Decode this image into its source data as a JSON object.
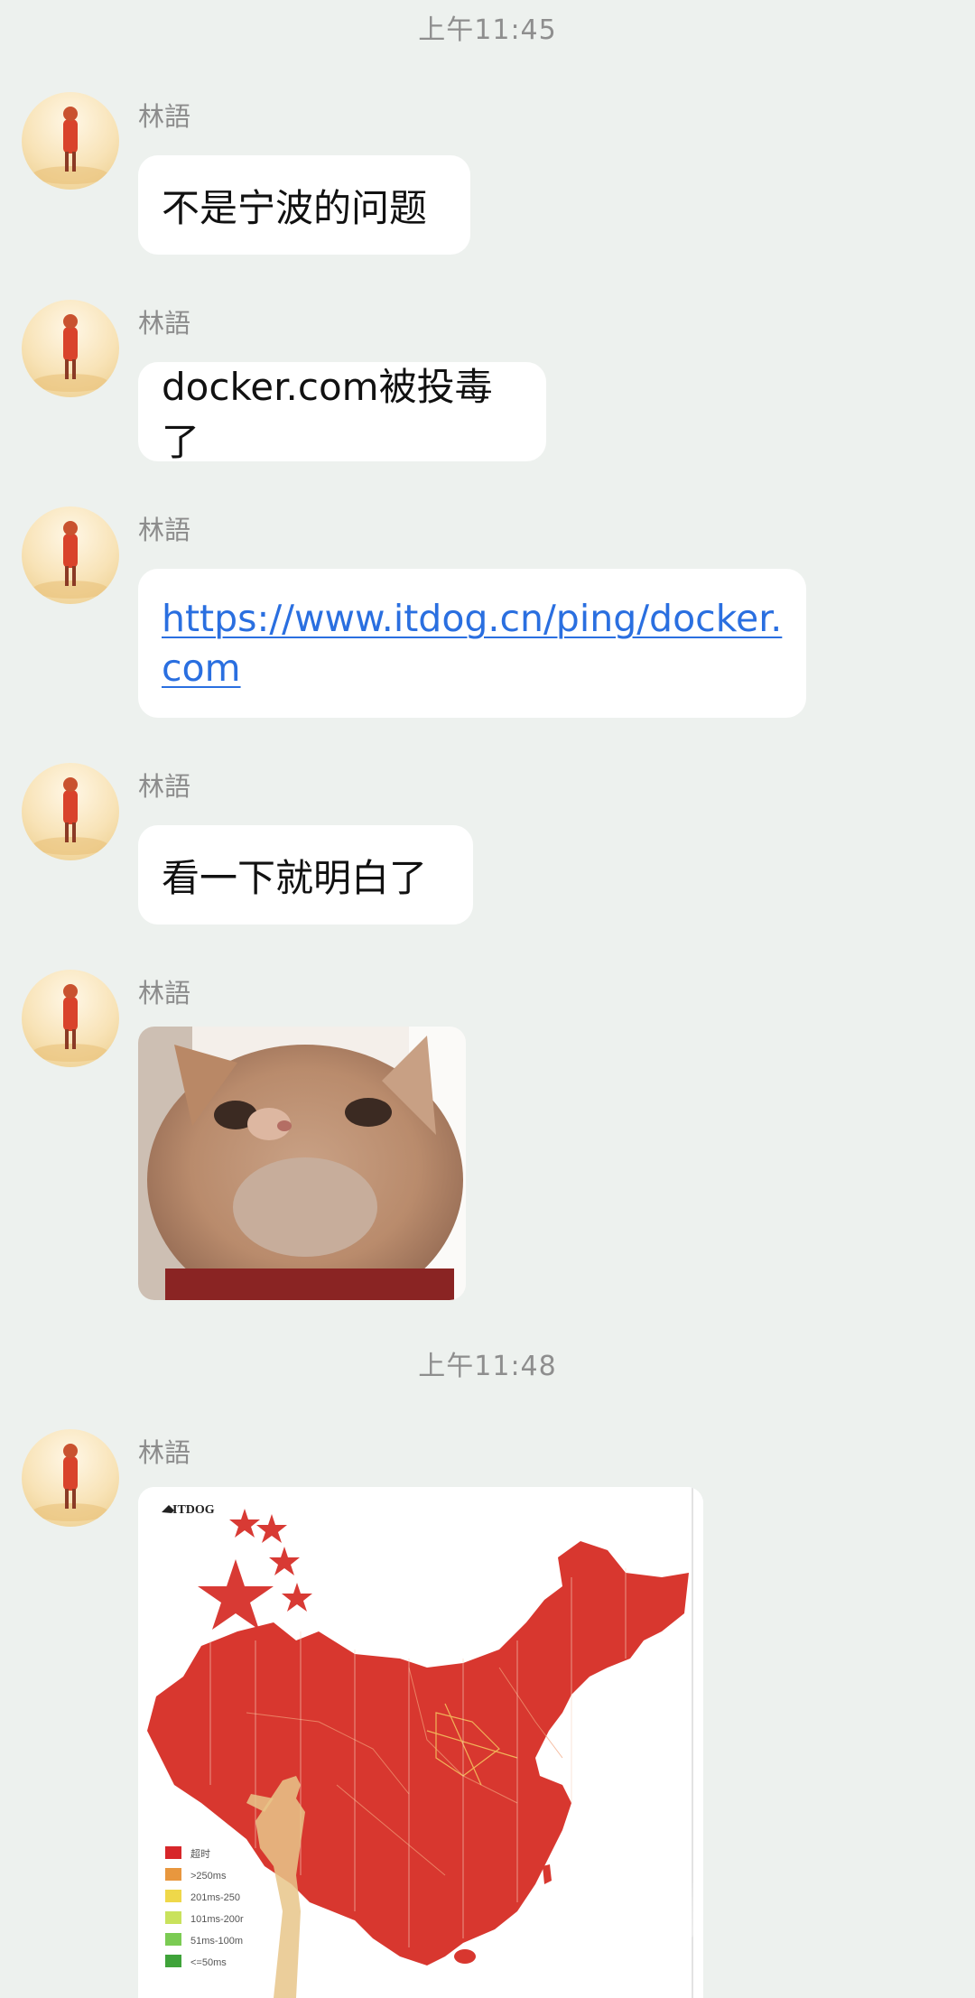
{
  "timestamps": [
    "上午11:45",
    "上午11:48"
  ],
  "messages": [
    {
      "sender": "林語",
      "text": "不是宁波的问题"
    },
    {
      "sender": "林語",
      "text": "docker.com被投毒了"
    },
    {
      "sender": "林語",
      "link": "https://www.itdog.cn/ping/docker.com"
    },
    {
      "sender": "林語",
      "text": "看一下就明白了"
    },
    {
      "sender": "林語",
      "image": "cat-sticker"
    },
    {
      "sender": "林語",
      "image": "itdog-ping-map"
    }
  ],
  "map_image": {
    "logo_text": "ITDOG",
    "legend": [
      "超时",
      ">250ms",
      "201ms-250",
      "101ms-200r",
      "51ms-100m",
      "<=50ms"
    ],
    "legend_colors": [
      "#D7262A",
      "#E8973E",
      "#EFD84A",
      "#C9E25C",
      "#7BCB53",
      "#3FA33A"
    ]
  },
  "colors": {
    "background": "#EDF1EE",
    "bubble": "#FFFFFF",
    "link": "#2A6FE0",
    "map_red": "#D8372F"
  }
}
